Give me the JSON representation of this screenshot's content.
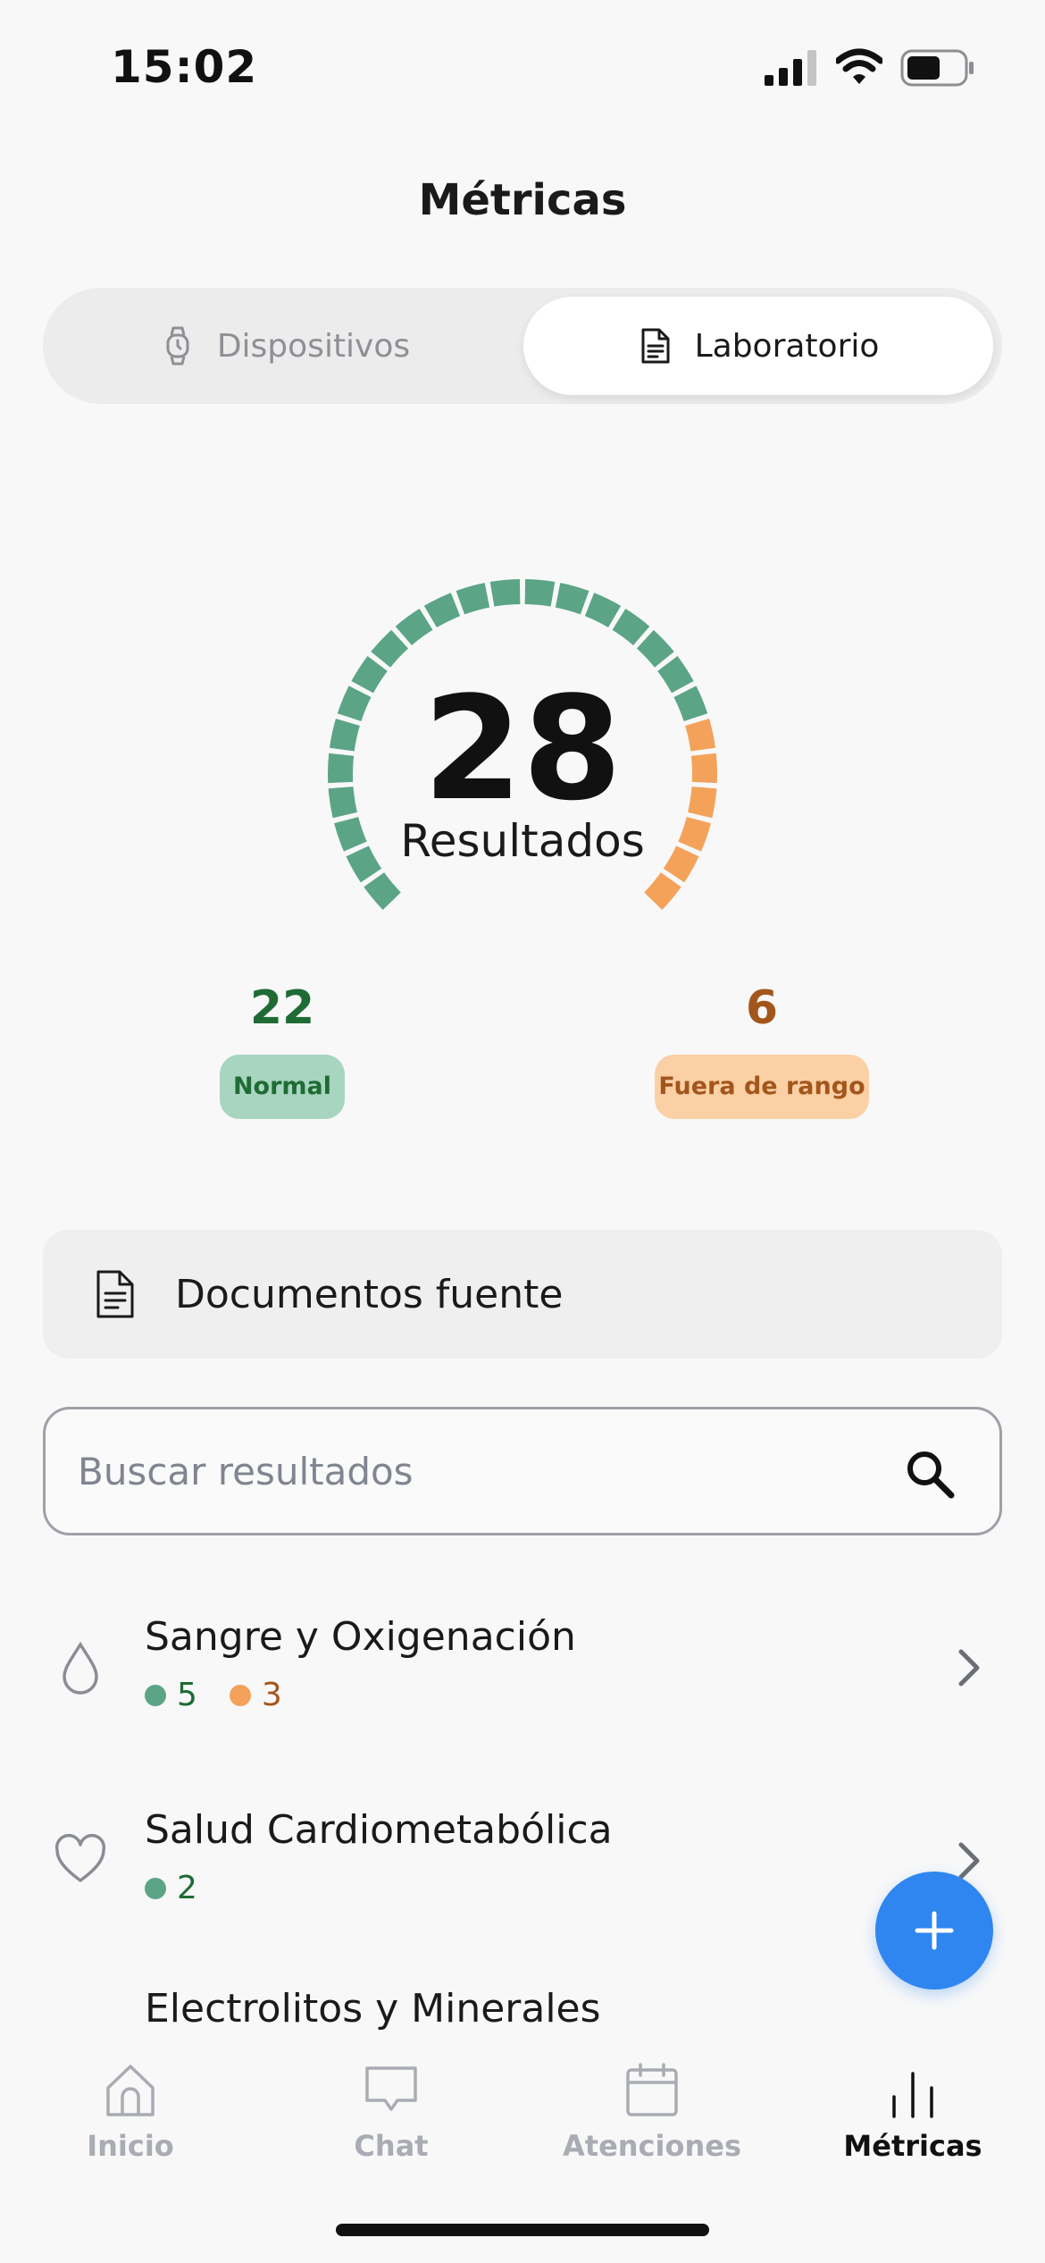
{
  "status": {
    "time": "15:02"
  },
  "header": {
    "title": "Métricas"
  },
  "tabs": [
    {
      "label": "Dispositivos",
      "icon": "watch-icon",
      "active": false
    },
    {
      "label": "Laboratorio",
      "icon": "document-icon",
      "active": true
    }
  ],
  "summary": {
    "total": "28",
    "total_label": "Resultados",
    "normal_count": "22",
    "normal_label": "Normal",
    "out_count": "6",
    "out_label": "Fuera de rango",
    "normal_fraction": 0.786,
    "colors": {
      "normal": "#5ba586",
      "out": "#f4a25a"
    }
  },
  "documents": {
    "label": "Documentos fuente"
  },
  "search": {
    "placeholder": "Buscar resultados"
  },
  "categories": [
    {
      "title": "Sangre y Oxigenación",
      "icon": "drop-icon",
      "normal": "5",
      "out": "3"
    },
    {
      "title": "Salud Cardiometabólica",
      "icon": "heart-icon",
      "normal": "2",
      "out": ""
    },
    {
      "title": "Electrolitos y Minerales",
      "icon": "mineral-icon",
      "normal": "",
      "out": ""
    }
  ],
  "nav": [
    {
      "label": "Inicio",
      "icon": "home-icon",
      "active": false
    },
    {
      "label": "Chat",
      "icon": "chat-icon",
      "active": false
    },
    {
      "label": "Atenciones",
      "icon": "calendar-icon",
      "active": false
    },
    {
      "label": "Métricas",
      "icon": "metrics-icon",
      "active": true
    }
  ]
}
